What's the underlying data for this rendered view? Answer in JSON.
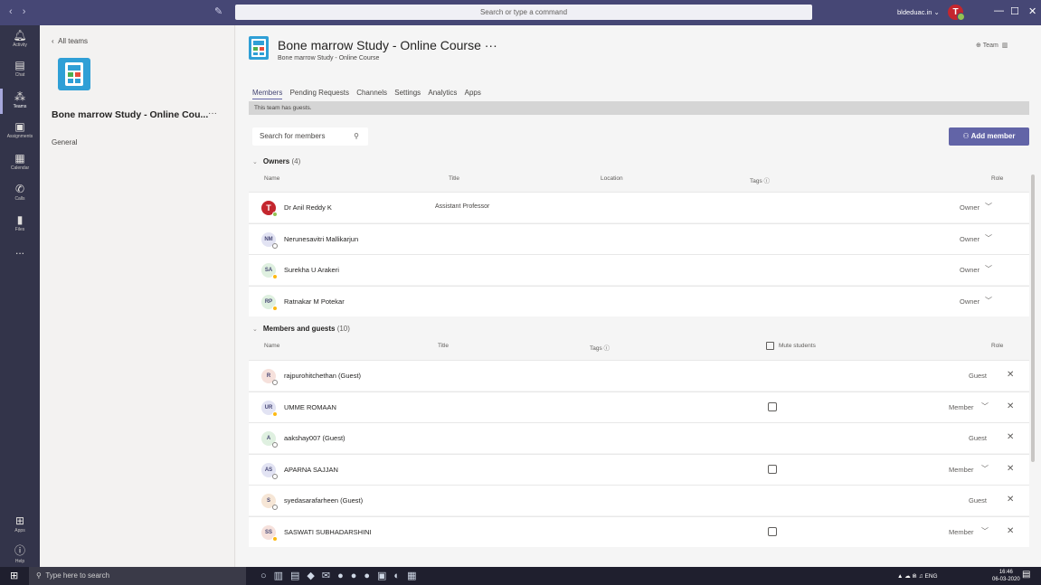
{
  "titlebar": {
    "search_placeholder": "Search or type a command",
    "account": "bldeduac.in ⌄",
    "avatar_initial": "T"
  },
  "rail": [
    {
      "label": "Activity",
      "icon": "bell-icon"
    },
    {
      "label": "Chat",
      "icon": "chat-icon"
    },
    {
      "label": "Teams",
      "icon": "teams-icon"
    },
    {
      "label": "Assignments",
      "icon": "assignments-icon"
    },
    {
      "label": "Calendar",
      "icon": "calendar-icon"
    },
    {
      "label": "Calls",
      "icon": "phone-icon"
    },
    {
      "label": "Files",
      "icon": "file-icon"
    },
    {
      "label": "...",
      "icon": "more-icon"
    },
    {
      "label": "Apps",
      "icon": "apps-icon"
    },
    {
      "label": "Help",
      "icon": "help-icon"
    }
  ],
  "left": {
    "back": "All teams",
    "team_name": "Bone marrow Study - Online Cou...",
    "more": "···",
    "channel": "General"
  },
  "header": {
    "title": "Bone marrow Study - Online Course ···",
    "subtitle": "Bone marrow Study - Online Course",
    "team_label": "Team"
  },
  "tabs": [
    "Members",
    "Pending Requests",
    "Channels",
    "Settings",
    "Analytics",
    "Apps"
  ],
  "banner": "This team has guests.",
  "search_placeholder": "Search for members",
  "add_member": "Add member",
  "owners": {
    "label": "Owners",
    "count": "(4)",
    "columns": {
      "name": "Name",
      "title": "Title",
      "location": "Location",
      "tags": "Tags ⓘ",
      "role": "Role"
    },
    "rows": [
      {
        "initials": "T",
        "name": "Dr Anil Reddy K",
        "title": "Assistant Professor",
        "role": "Owner",
        "status": "green",
        "color": "#c4262e"
      },
      {
        "initials": "NM",
        "name": "Nerunesavitri Mallikarjun",
        "title": "",
        "role": "Owner",
        "status": "grey",
        "color": "#e2e3f3"
      },
      {
        "initials": "SA",
        "name": "Surekha U Arakeri",
        "title": "",
        "role": "Owner",
        "status": "yellow",
        "color": "#dff0e0"
      },
      {
        "initials": "RP",
        "name": "Ratnakar M Potekar",
        "title": "",
        "role": "Owner",
        "status": "yellow",
        "color": "#dff0e0"
      }
    ]
  },
  "members": {
    "label": "Members and guests",
    "count": "(10)",
    "columns": {
      "name": "Name",
      "title": "Title",
      "tags": "Tags ⓘ",
      "mute": "Mute students",
      "role": "Role"
    },
    "rows": [
      {
        "initials": "R",
        "name": "rajpurohitchethan (Guest)",
        "role": "Guest",
        "checkbox": false,
        "chevron": false,
        "status": "grey",
        "color": "#f6e1dc"
      },
      {
        "initials": "UR",
        "name": "UMME ROMAAN",
        "role": "Member",
        "checkbox": true,
        "chevron": true,
        "status": "yellow",
        "color": "#e2e3f3"
      },
      {
        "initials": "A",
        "name": "aakshay007 (Guest)",
        "role": "Guest",
        "checkbox": false,
        "chevron": false,
        "status": "grey",
        "color": "#dff0e0"
      },
      {
        "initials": "AS",
        "name": "APARNA SAJJAN",
        "role": "Member",
        "checkbox": true,
        "chevron": true,
        "status": "grey",
        "color": "#e2e3f3"
      },
      {
        "initials": "S",
        "name": "syedasarafarheen (Guest)",
        "role": "Guest",
        "checkbox": false,
        "chevron": false,
        "status": "grey",
        "color": "#f6e6d6"
      },
      {
        "initials": "SS",
        "name": "SASWATI SUBHADARSHINI",
        "role": "Member",
        "checkbox": true,
        "chevron": true,
        "status": "yellow",
        "color": "#f6e1dc"
      }
    ]
  },
  "taskbar": {
    "search": "Type here to search",
    "lang": "ENG",
    "time": "16:46",
    "date": "06-03-2020"
  }
}
